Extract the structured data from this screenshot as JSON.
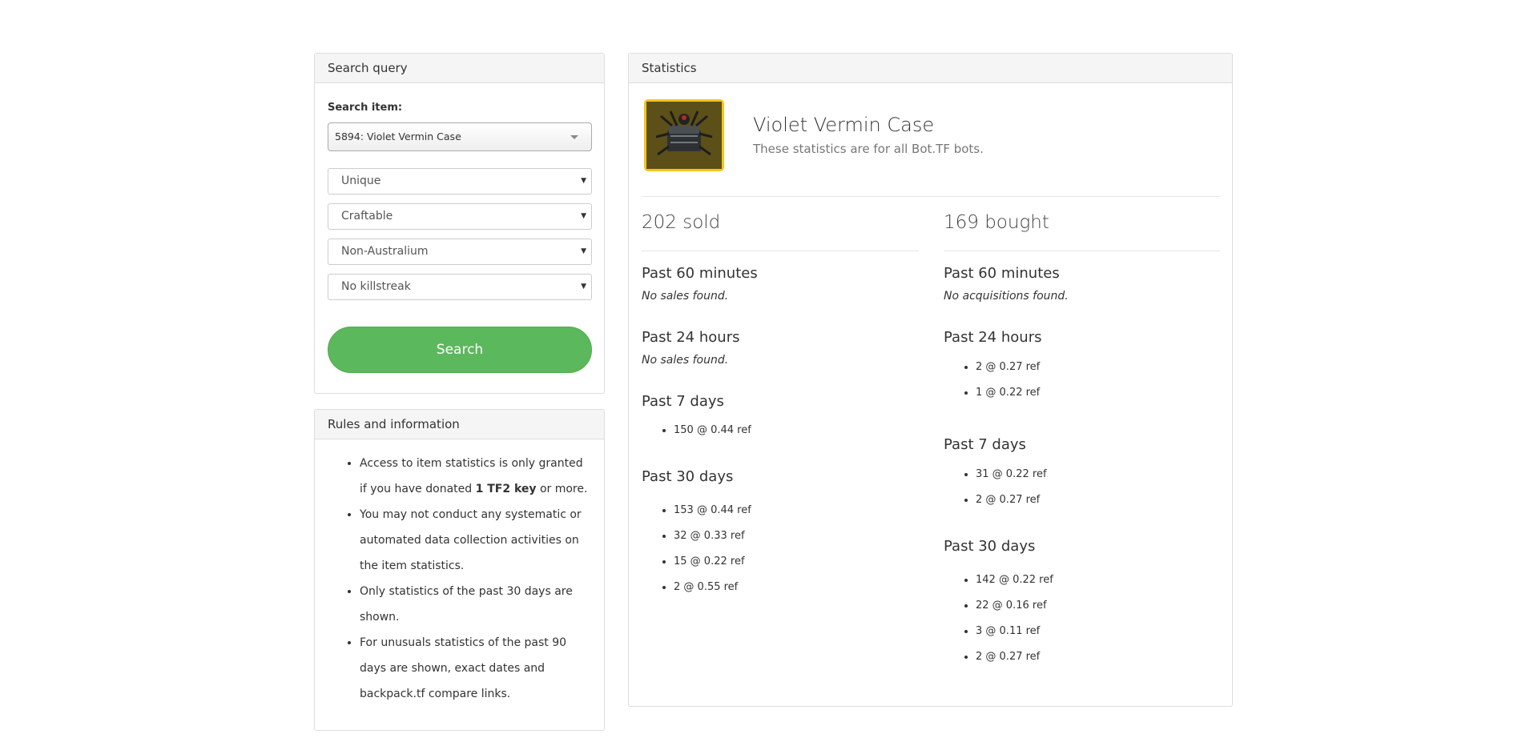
{
  "search_panel": {
    "title": "Search query",
    "item_label": "Search item:",
    "item_value": "5894: Violet Vermin Case",
    "selects": [
      "Unique",
      "Craftable",
      "Non-Australium",
      "No killstreak"
    ],
    "button": "Search",
    "button_color": "#5cb85c"
  },
  "rules_panel": {
    "title": "Rules and information",
    "rule1_pre": "Access to item statistics is only granted if you have donated ",
    "rule1_bold": "1 TF2 key",
    "rule1_post": " or more.",
    "rule2": "You may not conduct any systematic or automated data collection activities on the item statistics.",
    "rule3": "Only statistics of the past 30 days are shown.",
    "rule4": "For unusuals statistics of the past 90 days are shown, exact dates and backpack.tf compare links."
  },
  "stats_panel": {
    "title": "Statistics",
    "item_name": "Violet Vermin Case",
    "subtitle": "These statistics are for all Bot.TF bots.",
    "thumb_border": "#f5c518",
    "sold": {
      "heading": "202 sold",
      "p60_title": "Past 60 minutes",
      "p60_none": "No sales found.",
      "p24_title": "Past 24 hours",
      "p24_none": "No sales found.",
      "p7_title": "Past 7 days",
      "p7": [
        "150 @ 0.44 ref"
      ],
      "p30_title": "Past 30 days",
      "p30": [
        "153 @ 0.44 ref",
        "32 @ 0.33 ref",
        "15 @ 0.22 ref",
        "2 @ 0.55 ref"
      ]
    },
    "bought": {
      "heading": "169 bought",
      "p60_title": "Past 60 minutes",
      "p60_none": "No acquisitions found.",
      "p24_title": "Past 24 hours",
      "p24": [
        "2 @ 0.27 ref",
        "1 @ 0.22 ref"
      ],
      "p7_title": "Past 7 days",
      "p7": [
        "31 @ 0.22 ref",
        "2 @ 0.27 ref"
      ],
      "p30_title": "Past 30 days",
      "p30": [
        "142 @ 0.22 ref",
        "22 @ 0.16 ref",
        "3 @ 0.11 ref",
        "2 @ 0.27 ref"
      ]
    }
  }
}
